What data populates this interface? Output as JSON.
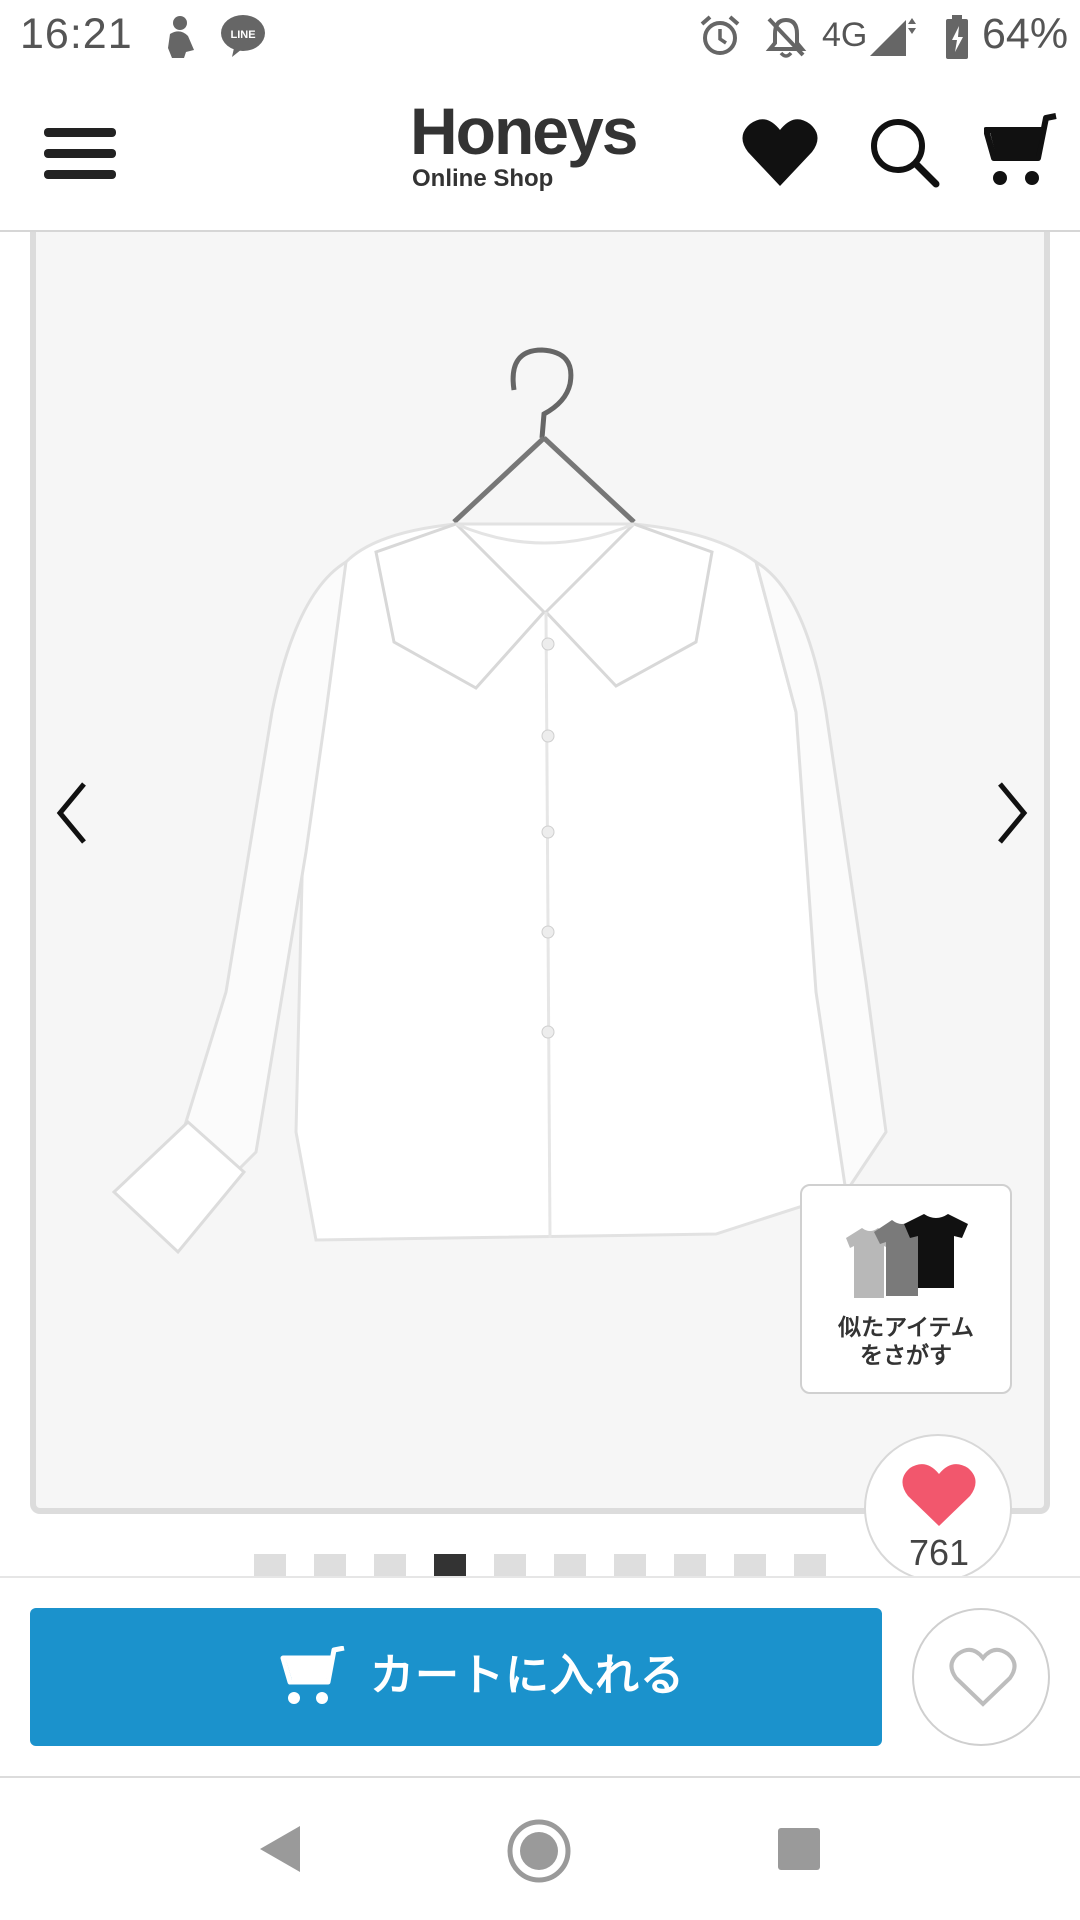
{
  "status_bar": {
    "time": "16:21",
    "network": "4G",
    "battery": "64%",
    "icons": [
      "person-notification-icon",
      "line-app-icon",
      "alarm-icon",
      "notifications-off-icon",
      "signal-icon",
      "battery-icon"
    ]
  },
  "header": {
    "logo_main": "Honeys",
    "logo_sub": "Online Shop",
    "icons": [
      "menu-icon",
      "heart-icon",
      "search-icon",
      "cart-icon"
    ]
  },
  "product": {
    "image_subject": "white-blouse",
    "similar_items_line1": "似たアイテム",
    "similar_items_line2": "をさがす",
    "like_count": "761",
    "carousel": {
      "total": 10,
      "active_index": 3
    }
  },
  "actions": {
    "add_to_cart_label": "カートに入れる",
    "accent_color": "#1b92cc"
  }
}
